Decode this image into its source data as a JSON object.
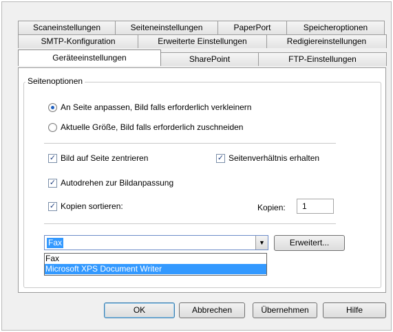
{
  "tabs_row1": [
    "Scaneinstellungen",
    "Seiteneinstellungen",
    "PaperPort",
    "Speicheroptionen"
  ],
  "tabs_row2": [
    "SMTP-Konfiguration",
    "Erweiterte Einstellungen",
    "Redigiereinstellungen"
  ],
  "tabs_row3": [
    "Geräteeinstellungen",
    "SharePoint",
    "FTP-Einstellungen"
  ],
  "active_tab": "Geräteeinstellungen",
  "group_title": "Seitenoptionen",
  "radio_fit": "An Seite anpassen, Bild falls erforderlich verkleinern",
  "radio_actual": "Aktuelle Größe, Bild falls erforderlich zuschneiden",
  "chk_center": "Bild auf Seite zentrieren",
  "chk_aspect": "Seitenverhältnis erhalten",
  "chk_autorotate": "Autodrehen zur Bildanpassung",
  "chk_collate": "Kopien sortieren:",
  "copies_label": "Kopien:",
  "copies_value": "1",
  "printer_selected": "Fax",
  "printer_options": [
    "Fax",
    "Microsoft XPS Document Writer"
  ],
  "highlighted_option": "Microsoft XPS Document Writer",
  "advanced_button": "Erweitert...",
  "btn_ok": "OK",
  "btn_cancel": "Abbrechen",
  "btn_apply": "Übernehmen",
  "btn_help": "Hilfe",
  "check_glyph": "✓",
  "combo_arrow": "▼"
}
